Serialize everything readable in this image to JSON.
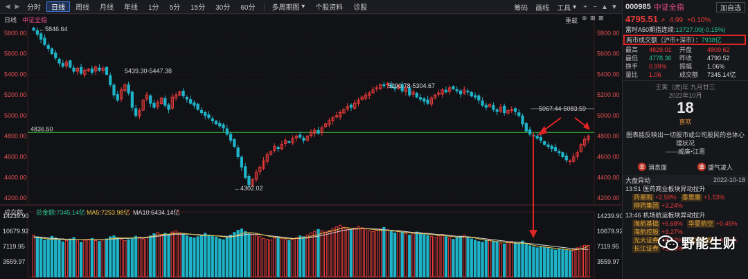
{
  "toolbar": {
    "periods": [
      "分时",
      "日线",
      "周线",
      "月线",
      "年线",
      "1分",
      "5分",
      "15分",
      "30分",
      "60分"
    ],
    "active_period": "日线",
    "multi_period": "多周期图",
    "stock_info": "个股资料",
    "diagnose": "诊股",
    "draw_line": "画线",
    "tools": "工具",
    "line_type": "筹码"
  },
  "chart_header": {
    "period": "日线",
    "name": "中证全指",
    "right_link": "重载"
  },
  "chart_data": {
    "type": "candlestick",
    "title": "中证全指",
    "y_ticks": [
      "5800.00",
      "5600.00",
      "5400.00",
      "5200.00",
      "5000.00",
      "4800.00",
      "4600.00",
      "4400.00",
      "4200.00"
    ],
    "ylim": [
      4160,
      5880
    ],
    "annotations": {
      "high": "5846.64",
      "range1": "5439.30-5447.38",
      "range2": "5290.78-5304.67",
      "range3": "5067.44-5083.59",
      "low": "4302.02",
      "hline_label": "4836.50"
    },
    "hline": 4836.5,
    "close_series": [
      5830,
      5790,
      5740,
      5690,
      5650,
      5600,
      5560,
      5510,
      5480,
      5520,
      5470,
      5430,
      5460,
      5410,
      5440,
      5450,
      5420,
      5470,
      5440,
      5460,
      5400,
      5300,
      5200,
      5150,
      5250,
      5300,
      5220,
      5080,
      5000,
      5050,
      5150,
      5200,
      5120,
      5080,
      5130,
      5170,
      5100,
      5060,
      5180,
      5200,
      5230,
      5190,
      5160,
      5120,
      5100,
      5060,
      5030,
      5000,
      4980,
      4950,
      4920,
      4900,
      4880,
      4820,
      4760,
      4700,
      4600,
      4500,
      4400,
      4330,
      4380,
      4450,
      4500,
      4560,
      4620,
      4650,
      4700,
      4680,
      4720,
      4760,
      4740,
      4780,
      4800,
      4790,
      4760,
      4800,
      4840,
      4860,
      4830,
      4880,
      4920,
      4950,
      4980,
      5000,
      5030,
      5060,
      5090,
      5080,
      5120,
      5150,
      5180,
      5200,
      5220,
      5250,
      5270,
      5300,
      5290,
      5310,
      5280,
      5260,
      5290,
      5240,
      5270,
      5200,
      5230,
      5180,
      5160,
      5140,
      5120,
      5170,
      5200,
      5220,
      5250,
      5230,
      5270,
      5260,
      5240,
      5210,
      5250,
      5230,
      5190,
      5180,
      5150,
      5100,
      5080,
      5110,
      5060,
      5040,
      5080,
      5030,
      5050,
      5060,
      5040,
      5000,
      4920,
      4850,
      4820,
      4800,
      4780,
      4760,
      4720,
      4700,
      4680,
      4660,
      4640,
      4600,
      4570,
      4560,
      4600,
      4640,
      4720,
      4770,
      4800
    ],
    "volume_header": {
      "name": "成交额",
      "total_label": "总金额:7345.14亿",
      "ma5_label": "MA5:7253.98亿",
      "ma10_label": "MA10:6434.14亿"
    },
    "volume_ticks": [
      "14239.90",
      "10679.92",
      "7119.95",
      "3559.97",
      "亿"
    ],
    "vol_max": 14239.9,
    "volume_series": [
      9800,
      9400,
      9200,
      8600,
      8800,
      9500,
      9100,
      8700,
      8200,
      8500,
      8900,
      9200,
      8400,
      8100,
      8600,
      8800,
      9000,
      8500,
      8300,
      8700,
      8900,
      9400,
      9600,
      9200,
      8800,
      8500,
      8700,
      9100,
      9500,
      9300,
      8900,
      9200,
      9600,
      10100,
      10400,
      9800,
      10200,
      9900,
      10500,
      10800,
      10300,
      9900,
      9600,
      9300,
      9100,
      9400,
      9700,
      10200,
      9800,
      9500,
      9300,
      8900,
      8700,
      9200,
      9800,
      10400,
      10900,
      11200,
      10600,
      10100,
      9900,
      9700,
      9400,
      9000,
      8800,
      8600,
      9100,
      9300,
      9000,
      8700,
      8500,
      8800,
      9200,
      9600,
      9400,
      9800,
      10300,
      10700,
      11100,
      10800,
      10500,
      10900,
      11300,
      11700,
      12100,
      11600,
      11200,
      10900,
      11400,
      11800,
      11500,
      11200,
      10800,
      10600,
      10900,
      11200,
      11600,
      11000,
      10600,
      10300,
      10700,
      10400,
      10100,
      9800,
      10200,
      10500,
      10300,
      10000,
      9700,
      9500,
      9200,
      9600,
      9900,
      9400,
      9100,
      8800,
      9200,
      9500,
      9800,
      9300,
      8900,
      8600,
      8300,
      8100,
      8500,
      8700,
      8400,
      8200,
      7900,
      7700,
      8000,
      8300,
      8100,
      7800,
      8400,
      7600,
      7300,
      7000,
      6800,
      7100,
      6900,
      6700,
      6500,
      6300,
      6600,
      6400,
      6200,
      6100,
      6500,
      6800,
      7100,
      7400,
      7345
    ],
    "ma_yellow": [
      9200,
      9200,
      9100,
      9000,
      8900,
      8800,
      8800,
      8700,
      8700,
      8700,
      8700,
      8700,
      8700,
      8700,
      8700,
      8700,
      8700,
      8700,
      8700,
      8700,
      8800,
      8900,
      9000,
      9100,
      9100,
      9100,
      9100,
      9100,
      9100,
      9200,
      9200,
      9300,
      9400,
      9600,
      9800,
      9900,
      10000,
      10000,
      10100,
      10200,
      10200,
      10200,
      10100,
      10000,
      9900,
      9800,
      9700,
      9700,
      9700,
      9700,
      9600,
      9500,
      9400,
      9300,
      9300,
      9500,
      9800,
      10100,
      10300,
      10400,
      10300,
      10200,
      10000,
      9800,
      9600,
      9400,
      9300,
      9200,
      9100,
      9000,
      8900,
      8900,
      9000,
      9100,
      9200,
      9300,
      9500,
      9700,
      9900,
      10200,
      10400,
      10600,
      10800,
      11000,
      11300,
      11500,
      11500,
      11400,
      11300,
      11300,
      11300,
      11300,
      11200,
      11100,
      11000,
      10900,
      10900,
      10900,
      10800,
      10700,
      10600,
      10500,
      10400,
      10300,
      10200,
      10200,
      10100,
      10100,
      10000,
      9900,
      9800,
      9700,
      9700,
      9600,
      9500,
      9400,
      9300,
      9300,
      9300,
      9300,
      9200,
      9100,
      8900,
      8700,
      8600,
      8500,
      8400,
      8300,
      8200,
      8100,
      8000,
      8000,
      7900,
      7900,
      7900,
      7800,
      7600,
      7400,
      7200,
      7100,
      7000,
      6900,
      6800,
      6700,
      6600,
      6500,
      6400,
      6300,
      6300,
      6400,
      6600,
      6800,
      7250
    ],
    "ma_white": [
      9400,
      9300,
      9300,
      9200,
      9100,
      9000,
      9000,
      8900,
      8900,
      8800,
      8800,
      8800,
      8700,
      8700,
      8700,
      8700,
      8700,
      8700,
      8700,
      8700,
      8800,
      8800,
      8900,
      8900,
      9000,
      9000,
      9000,
      9100,
      9100,
      9100,
      9100,
      9200,
      9300,
      9400,
      9500,
      9600,
      9700,
      9800,
      9900,
      10000,
      10000,
      10000,
      10000,
      10000,
      9900,
      9900,
      9800,
      9800,
      9700,
      9700,
      9600,
      9600,
      9500,
      9500,
      9500,
      9500,
      9600,
      9700,
      9900,
      10000,
      10000,
      10000,
      9900,
      9800,
      9700,
      9600,
      9500,
      9400,
      9300,
      9200,
      9100,
      9000,
      9000,
      9000,
      9100,
      9100,
      9200,
      9400,
      9500,
      9700,
      9900,
      10100,
      10300,
      10500,
      10700,
      10900,
      11000,
      11100,
      11200,
      11200,
      11300,
      11300,
      11300,
      11200,
      11200,
      11100,
      11000,
      11000,
      10900,
      10800,
      10800,
      10700,
      10600,
      10500,
      10400,
      10400,
      10300,
      10200,
      10200,
      10100,
      10000,
      9900,
      9900,
      9800,
      9700,
      9600,
      9500,
      9500,
      9400,
      9400,
      9300,
      9200,
      9100,
      9000,
      8900,
      8800,
      8700,
      8600,
      8500,
      8400,
      8300,
      8200,
      8100,
      8100,
      8000,
      7900,
      7800,
      7700,
      7600,
      7500,
      7400,
      7300,
      7200,
      7100,
      7000,
      6900,
      6800,
      6700,
      6600,
      6500,
      6500,
      6450,
      6434
    ]
  },
  "panel": {
    "code": "000985",
    "name": "中证全指",
    "add_button": "加自选",
    "price": "4795.51",
    "trend_arrow": "↗",
    "change": "4.99",
    "change_pct": "+0.10%",
    "line1_label": "富时A50期指连续:",
    "line1_value": "13727.00(-0.15%)",
    "amount_label": "两市成交额（沪市+深市）：",
    "amount_value": "7938亿",
    "stats": [
      [
        "最高",
        "4829.01",
        "开盘",
        "4809.62"
      ],
      [
        "最低",
        "4778.36",
        "昨收",
        "4790.52"
      ],
      [
        "换手",
        "0.99%",
        "振幅",
        "1.06%"
      ],
      [
        "量比",
        "1.06",
        "成交额",
        "7345.14亿"
      ]
    ],
    "calendar": {
      "lunar": "壬寅（虎)年 九月廿三",
      "year_month": "2022年10月",
      "day": "18",
      "yi": "喜欢"
    },
    "quote": "图表能反映出一切股市或公司股民的总体心理状况",
    "author": "——威廉•江恩",
    "links": [
      {
        "icon": "宣",
        "label": "消息面"
      },
      {
        "icon": "盛",
        "label": "盛气凌人"
      }
    ],
    "dapan": {
      "title": "大盘异动",
      "date": "2022-10-18",
      "events": [
        {
          "time": "13:51",
          "text": "医药商业板块异动拉升",
          "stocks": [
            {
              "name": "药易购",
              "pct": "+2.58%"
            },
            {
              "name": "泰恩康",
              "pct": "+1.53%"
            },
            {
              "name": "柳药集团",
              "pct": "+3.24%"
            }
          ]
        },
        {
          "time": "13:46",
          "text": "机场航运板块异动拉升",
          "stocks": [
            {
              "name": "海航基础",
              "pct": "+6.68%"
            },
            {
              "name": "华夏航空",
              "pct": "+0.45%"
            },
            {
              "name": "海航控股",
              "pct": "+3.27%"
            }
          ]
        },
        {
          "time": "",
          "text": "",
          "stocks": [
            {
              "name": "光大证券",
              "pct": "+0.07%"
            },
            {
              "name": "锦龙股份",
              "pct": "+0.15%"
            },
            {
              "name": "长江证券",
              "pct": "+3.88%"
            }
          ]
        }
      ]
    }
  },
  "watermark": "野能生财",
  "colors": {
    "up": "#ee3b3b",
    "down": "#1fb3c8",
    "hline": "#3dbb3d",
    "ma_yellow": "#e6c34a",
    "ma_white": "#d8d8d8",
    "annotation_arrow": "#e02424"
  }
}
